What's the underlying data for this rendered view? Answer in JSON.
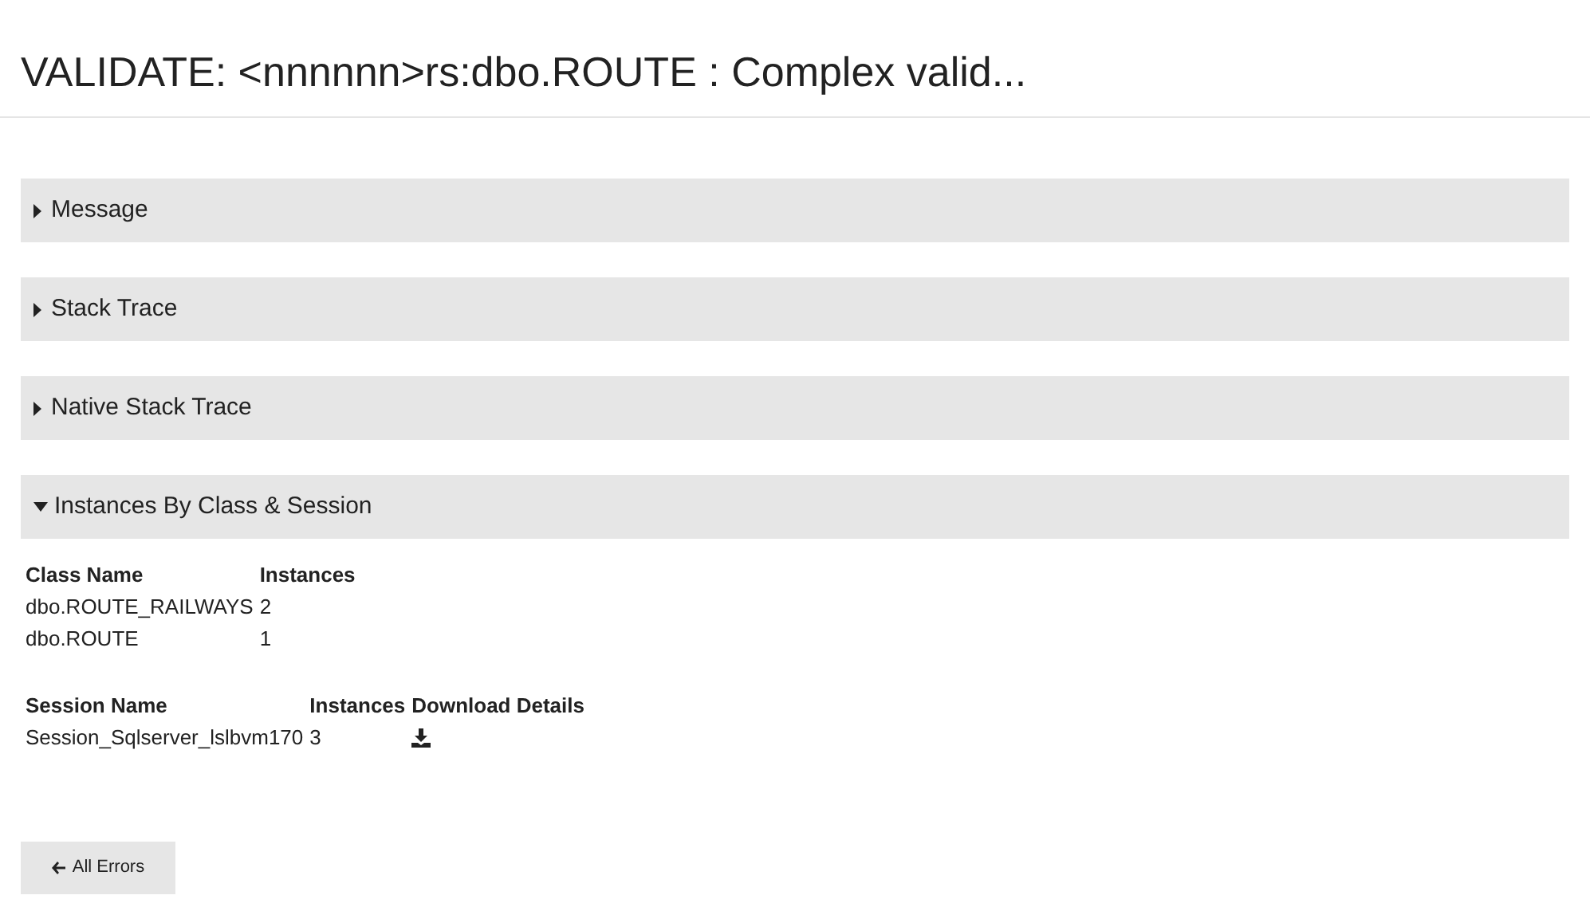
{
  "title": "VALIDATE: <nnnnnn>rs:dbo.ROUTE : Complex valid...",
  "sections": [
    {
      "label": "Message",
      "expanded": false
    },
    {
      "label": "Stack Trace",
      "expanded": false
    },
    {
      "label": "Native Stack Trace",
      "expanded": false
    },
    {
      "label": "Instances By Class & Session",
      "expanded": true
    }
  ],
  "class_table": {
    "columns": [
      "Class Name",
      "Instances"
    ],
    "rows": [
      [
        "dbo.ROUTE_RAILWAYS",
        "2"
      ],
      [
        "dbo.ROUTE",
        "1"
      ]
    ]
  },
  "session_table": {
    "columns": [
      "Session Name",
      "Instances",
      "Download Details"
    ],
    "rows": [
      [
        "Session_Sqlserver_lslbvm170",
        "3"
      ]
    ]
  },
  "back_button": {
    "label": "All Errors"
  }
}
